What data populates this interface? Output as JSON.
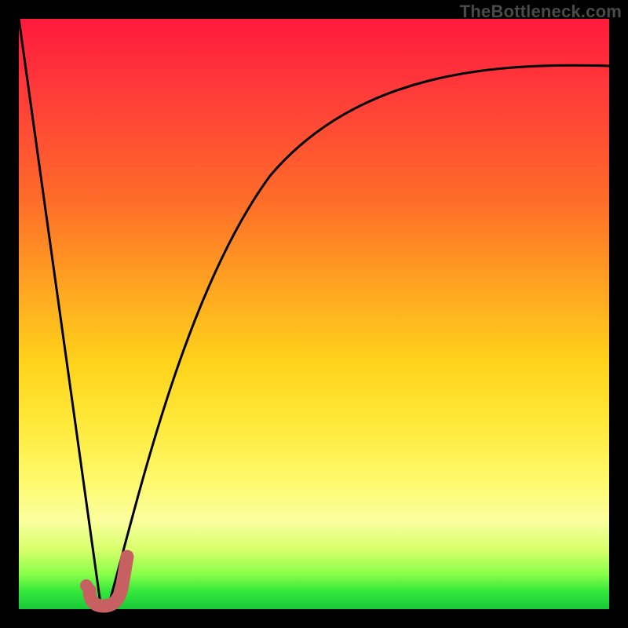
{
  "watermark": "TheBottleneck.com",
  "colors": {
    "frame": "#000000",
    "gradient_top": "#ff1a3c",
    "gradient_bottom": "#18c93a",
    "curve": "#000000",
    "marker": "#c86464"
  },
  "chart_data": {
    "type": "line",
    "title": "",
    "xlabel": "",
    "ylabel": "",
    "xlim": [
      0,
      100
    ],
    "ylim": [
      0,
      100
    ],
    "x": [
      0,
      2,
      4,
      6,
      8,
      10,
      12,
      13,
      14,
      15,
      16,
      17,
      18,
      19,
      20,
      22,
      25,
      30,
      35,
      40,
      45,
      50,
      55,
      60,
      65,
      70,
      75,
      80,
      85,
      90,
      95,
      100
    ],
    "values": [
      100,
      85,
      70,
      56,
      41,
      27,
      12,
      5,
      0,
      0,
      1,
      4,
      10,
      17,
      24,
      36,
      50,
      64,
      72,
      78,
      82,
      85,
      87,
      88.5,
      89.5,
      90.3,
      90.9,
      91.3,
      91.6,
      91.8,
      91.9,
      92
    ],
    "marker": {
      "shape": "J",
      "x_range": [
        12.5,
        18
      ],
      "y_range": [
        0,
        8
      ]
    }
  }
}
